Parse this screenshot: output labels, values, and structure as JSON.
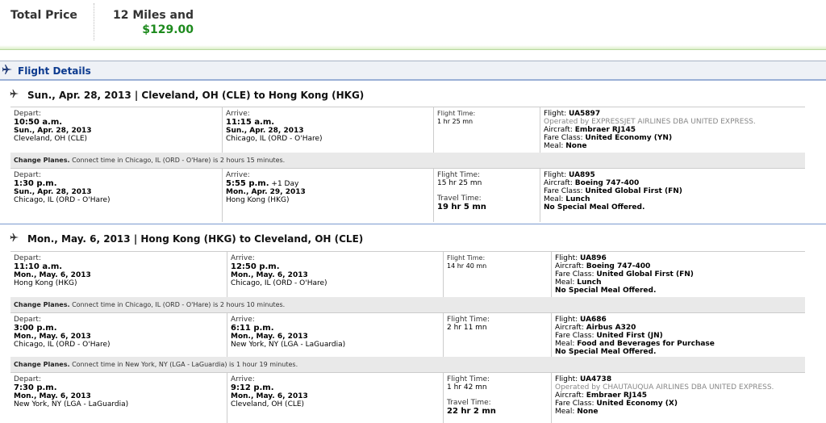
{
  "price": {
    "label": "Total Price",
    "miles": "12 Miles and",
    "amount": "$129.00"
  },
  "flight_details": {
    "title": "Flight Details",
    "icon": "plane-icon"
  },
  "labels": {
    "depart": "Depart:",
    "arrive": "Arrive:",
    "flight_time": "Flight Time:",
    "travel_time": "Travel Time:",
    "flight": "Flight:",
    "aircraft": "Aircraft:",
    "fare_class": "Fare Class:",
    "meal": "Meal:",
    "change_planes": "Change Planes."
  },
  "trips": [
    {
      "header": "Sun., Apr. 28, 2013 | Cleveland, OH (CLE) to Hong Kong (HKG)",
      "segments": [
        {
          "depart_time": "10:50 a.m.",
          "depart_date": "Sun., Apr. 28, 2013",
          "depart_place": "Cleveland, OH (CLE)",
          "arrive_time": "11:15 a.m.",
          "arrive_extra": "",
          "arrive_date": "Sun., Apr. 28, 2013",
          "arrive_place": "Chicago, IL (ORD - O'Hare)",
          "flight_time": "1 hr 25 mn",
          "travel_time": "",
          "flight": "UA5897",
          "operated_by": "Operated by EXPRESSJET AIRLINES DBA UNITED EXPRESS.",
          "aircraft": "Embraer RJ145",
          "fare_class": "United Economy (YN)",
          "meal": "None",
          "meal_note": ""
        },
        {
          "depart_time": "1:30 p.m.",
          "depart_date": "Sun., Apr. 28, 2013",
          "depart_place": "Chicago, IL (ORD - O'Hare)",
          "arrive_time": "5:55 p.m.",
          "arrive_extra": "+1 Day",
          "arrive_date": "Mon., Apr. 29, 2013",
          "arrive_place": "Hong Kong (HKG)",
          "flight_time": "15 hr 25 mn",
          "travel_time": "19 hr 5 mn",
          "flight": "UA895",
          "operated_by": "",
          "aircraft": "Boeing 747-400",
          "fare_class": "United Global First (FN)",
          "meal": "Lunch",
          "meal_note": "No Special Meal Offered."
        }
      ],
      "changes": [
        "Connect time in Chicago, IL (ORD - O'Hare) is 2 hours 15 minutes."
      ]
    },
    {
      "header": "Mon., May. 6, 2013 | Hong Kong (HKG) to Cleveland, OH (CLE)",
      "segments": [
        {
          "depart_time": "11:10 a.m.",
          "depart_date": "Mon., May. 6, 2013",
          "depart_place": "Hong Kong (HKG)",
          "arrive_time": "12:50 p.m.",
          "arrive_extra": "",
          "arrive_date": "Mon., May. 6, 2013",
          "arrive_place": "Chicago, IL (ORD - O'Hare)",
          "flight_time": "14 hr 40 mn",
          "travel_time": "",
          "flight": "UA896",
          "operated_by": "",
          "aircraft": "Boeing 747-400",
          "fare_class": "United Global First (FN)",
          "meal": "Lunch",
          "meal_note": "No Special Meal Offered."
        },
        {
          "depart_time": "3:00 p.m.",
          "depart_date": "Mon., May. 6, 2013",
          "depart_place": "Chicago, IL (ORD - O'Hare)",
          "arrive_time": "6:11 p.m.",
          "arrive_extra": "",
          "arrive_date": "Mon., May. 6, 2013",
          "arrive_place": "New York, NY (LGA - LaGuardia)",
          "flight_time": "2 hr 11 mn",
          "travel_time": "",
          "flight": "UA686",
          "operated_by": "",
          "aircraft": "Airbus A320",
          "fare_class": "United First (JN)",
          "meal": "Food and Beverages for Purchase",
          "meal_note": "No Special Meal Offered."
        },
        {
          "depart_time": "7:30 p.m.",
          "depart_date": "Mon., May. 6, 2013",
          "depart_place": "New York, NY (LGA - LaGuardia)",
          "arrive_time": "9:12 p.m.",
          "arrive_extra": "",
          "arrive_date": "Mon., May. 6, 2013",
          "arrive_place": "Cleveland, OH (CLE)",
          "flight_time": "1 hr 42 mn",
          "travel_time": "22 hr 2 mn",
          "flight": "UA4738",
          "operated_by": "Operated by CHAUTAUQUA AIRLINES DBA UNITED EXPRESS.",
          "aircraft": "Embraer RJ145",
          "fare_class": "United Economy (X)",
          "meal": "None",
          "meal_note": ""
        }
      ],
      "changes": [
        "Connect time in Chicago, IL (ORD - O'Hare) is 2 hours 10 minutes.",
        "Connect time in New York, NY (LGA - LaGuardia) is 1 hour 19 minutes."
      ]
    }
  ]
}
